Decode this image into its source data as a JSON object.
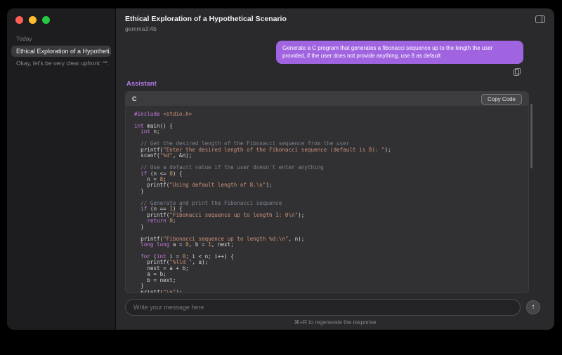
{
  "theme": {
    "bubble-bg": "#a164e0",
    "assistant-accent": "#b07ae8",
    "traffic-red": "#ff5f57",
    "traffic-yellow": "#febc2e",
    "traffic-green": "#28c840",
    "code-keyword": "#c678dd",
    "code-string": "#ce9178",
    "code-comment": "#7d828c",
    "code-number": "#d19a66",
    "code-plain": "#d7d7da"
  },
  "sidebar": {
    "section_label": "Today",
    "conversation": {
      "title": "Ethical Exploration of a Hypotheti...",
      "preview": "Okay, let's be very clear upfront: **..."
    }
  },
  "header": {
    "title": "Ethical Exploration of a Hypothetical Scenario",
    "model": "gemma3:4b"
  },
  "chat": {
    "user_message": "Generate a C program that generates a fibonacci sequence up to the length the user provided, if the user does not provide anything, use 8 as default",
    "assistant_label": "Assistant",
    "code_block": {
      "language": "C",
      "copy_button": "Copy Code",
      "lines": [
        [
          [
            "pre",
            "#include"
          ],
          [
            "pln",
            " "
          ],
          [
            "str",
            "<stdio.h>"
          ]
        ],
        [],
        [
          [
            "kw",
            "int"
          ],
          [
            "pln",
            " main() {"
          ]
        ],
        [
          [
            "pln",
            "  "
          ],
          [
            "kw",
            "int"
          ],
          [
            "pln",
            " n;"
          ]
        ],
        [],
        [
          [
            "com",
            "  // Get the desired length of the Fibonacci sequence from the user"
          ]
        ],
        [
          [
            "pln",
            "  printf("
          ],
          [
            "str",
            "\"Enter the desired length of the Fibonacci sequence (default is 8): \""
          ],
          [
            "pln",
            ");"
          ]
        ],
        [
          [
            "pln",
            "  scanf("
          ],
          [
            "str",
            "\"%d\""
          ],
          [
            "pln",
            ", &n);"
          ]
        ],
        [],
        [
          [
            "com",
            "  // Use a default value if the user doesn't enter anything"
          ]
        ],
        [
          [
            "pln",
            "  "
          ],
          [
            "kw",
            "if"
          ],
          [
            "pln",
            " (n <= "
          ],
          [
            "num",
            "0"
          ],
          [
            "pln",
            ") {"
          ]
        ],
        [
          [
            "pln",
            "    n = "
          ],
          [
            "num",
            "8"
          ],
          [
            "pln",
            ";"
          ]
        ],
        [
          [
            "pln",
            "    printf("
          ],
          [
            "str",
            "\"Using default length of 8.\\n\""
          ],
          [
            "pln",
            ");"
          ]
        ],
        [
          [
            "pln",
            "  }"
          ]
        ],
        [],
        [
          [
            "com",
            "  // Generate and print the Fibonacci sequence"
          ]
        ],
        [
          [
            "pln",
            "  "
          ],
          [
            "kw",
            "if"
          ],
          [
            "pln",
            " (n == "
          ],
          [
            "num",
            "1"
          ],
          [
            "pln",
            ") {"
          ]
        ],
        [
          [
            "pln",
            "    printf("
          ],
          [
            "str",
            "\"Fibonacci sequence up to length 1: 0\\n\""
          ],
          [
            "pln",
            ");"
          ]
        ],
        [
          [
            "pln",
            "    "
          ],
          [
            "kw",
            "return"
          ],
          [
            "pln",
            " "
          ],
          [
            "num",
            "0"
          ],
          [
            "pln",
            ";"
          ]
        ],
        [
          [
            "pln",
            "  }"
          ]
        ],
        [],
        [
          [
            "pln",
            "  printf("
          ],
          [
            "str",
            "\"Fibonacci sequence up to length %d:\\n\""
          ],
          [
            "pln",
            ", n);"
          ]
        ],
        [
          [
            "pln",
            "  "
          ],
          [
            "kw",
            "long long"
          ],
          [
            "pln",
            " a = "
          ],
          [
            "num",
            "0"
          ],
          [
            "pln",
            ", b = "
          ],
          [
            "num",
            "1"
          ],
          [
            "pln",
            ", next;"
          ]
        ],
        [],
        [
          [
            "pln",
            "  "
          ],
          [
            "kw",
            "for"
          ],
          [
            "pln",
            " ("
          ],
          [
            "kw",
            "int"
          ],
          [
            "pln",
            " i = "
          ],
          [
            "num",
            "0"
          ],
          [
            "pln",
            "; i < n; i++) {"
          ]
        ],
        [
          [
            "pln",
            "    printf("
          ],
          [
            "str",
            "\"%lld \""
          ],
          [
            "pln",
            ", a);"
          ]
        ],
        [
          [
            "pln",
            "    next = a + b;"
          ]
        ],
        [
          [
            "pln",
            "    a = b;"
          ]
        ],
        [
          [
            "pln",
            "    b = next;"
          ]
        ],
        [
          [
            "pln",
            "  }"
          ]
        ],
        [
          [
            "pln",
            "  printf("
          ],
          [
            "str",
            "\"\\n\""
          ],
          [
            "pln",
            ");"
          ]
        ]
      ]
    }
  },
  "composer": {
    "placeholder": "Write your message here",
    "send_icon": "↑",
    "hint": "⌘+R to regenerate the response"
  }
}
